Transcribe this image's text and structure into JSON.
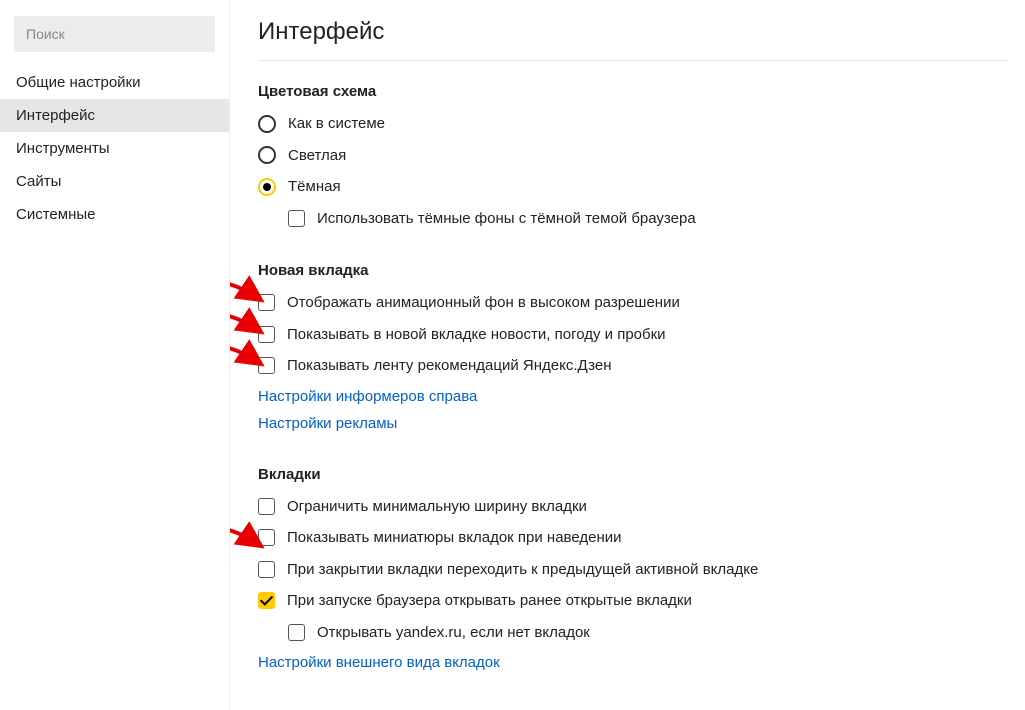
{
  "sidebar": {
    "search_placeholder": "Поиск",
    "items": [
      {
        "label": "Общие настройки",
        "active": false
      },
      {
        "label": "Интерфейс",
        "active": true
      },
      {
        "label": "Инструменты",
        "active": false
      },
      {
        "label": "Сайты",
        "active": false
      },
      {
        "label": "Системные",
        "active": false
      }
    ]
  },
  "page": {
    "title": "Интерфейс"
  },
  "color_scheme": {
    "title": "Цветовая схема",
    "options": [
      {
        "label": "Как в системе",
        "selected": false
      },
      {
        "label": "Светлая",
        "selected": false
      },
      {
        "label": "Тёмная",
        "selected": true
      }
    ],
    "dark_bg_option": "Использовать тёмные фоны с тёмной темой браузера"
  },
  "new_tab": {
    "title": "Новая вкладка",
    "opt_anim_bg": "Отображать анимационный фон в высоком разрешении",
    "opt_news": "Показывать в новой вкладке новости, погоду и пробки",
    "opt_zen": "Показывать ленту рекомендаций Яндекс.Дзен",
    "link_informers": "Настройки информеров справа",
    "link_ads": "Настройки рекламы"
  },
  "tabs": {
    "title": "Вкладки",
    "opt_min_width": "Ограничить минимальную ширину вкладки",
    "opt_thumbnails": "Показывать миниатюры вкладок при наведении",
    "opt_prev_tab": "При закрытии вкладки переходить к предыдущей активной вкладке",
    "opt_restore": "При запуске браузера открывать ранее открытые вкладки",
    "opt_open_yandex": "Открывать yandex.ru, если нет вкладок",
    "link_appearance": "Настройки внешнего вида вкладок"
  }
}
